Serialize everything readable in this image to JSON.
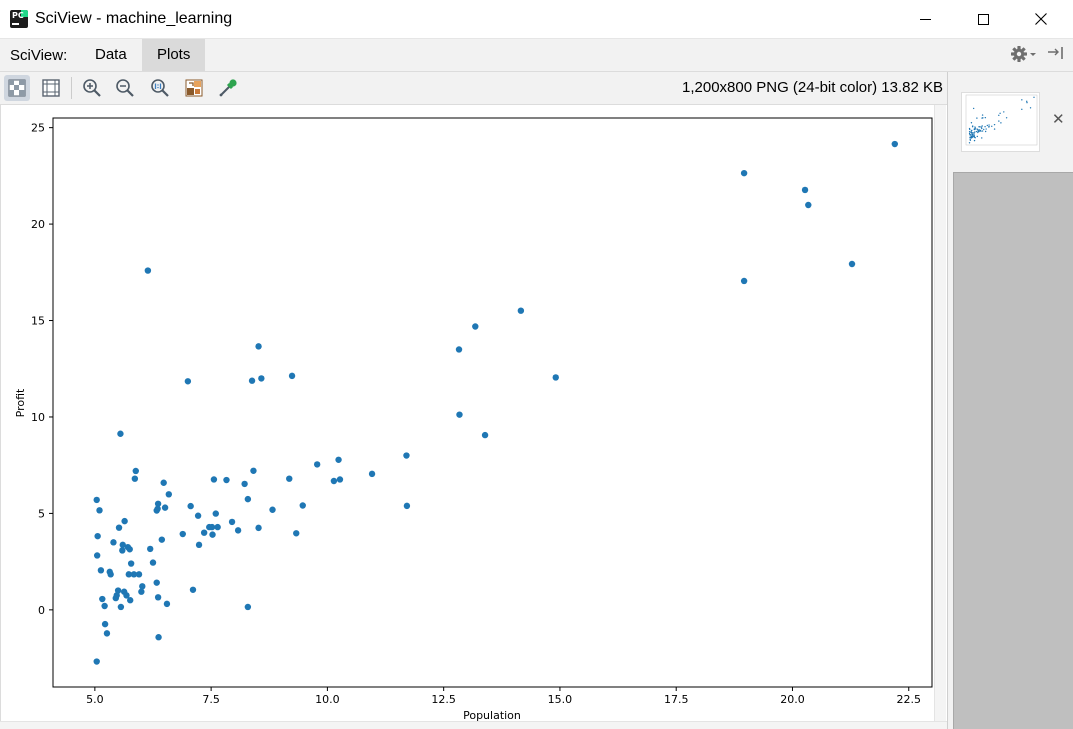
{
  "window": {
    "title": "SciView - machine_learning"
  },
  "tabs": {
    "prefix": "SciView:",
    "items": [
      "Data",
      "Plots"
    ],
    "active": "Plots"
  },
  "toolbar": {
    "tools": [
      "grid-toggle-icon",
      "fit-frame-icon",
      "zoom-in-icon",
      "zoom-out-icon",
      "actual-size-icon",
      "palette-icon",
      "color-picker-icon"
    ]
  },
  "image_info": "1,200x800 PNG (24-bit color) 13.82 KB",
  "colors": {
    "marker": "#1f77b4",
    "tab_active": "#dadada",
    "panel_gray": "#bfbfbf"
  },
  "chart_data": {
    "type": "scatter",
    "title": "",
    "xlabel": "Population",
    "ylabel": "Profit",
    "xlim": [
      4.1,
      23.0
    ],
    "ylim": [
      -4.0,
      25.5
    ],
    "xticks": [
      "5.0",
      "7.5",
      "10.0",
      "12.5",
      "15.0",
      "17.5",
      "20.0",
      "22.5"
    ],
    "yticks": [
      "0",
      "5",
      "10",
      "15",
      "20",
      "25"
    ],
    "grid": false,
    "points": [
      [
        5.04,
        5.7
      ],
      [
        5.1,
        5.16
      ],
      [
        5.06,
        3.82
      ],
      [
        5.05,
        2.82
      ],
      [
        5.13,
        2.05
      ],
      [
        5.16,
        0.56
      ],
      [
        5.22,
        -0.74
      ],
      [
        5.21,
        0.2
      ],
      [
        5.26,
        -1.22
      ],
      [
        5.04,
        -2.68
      ],
      [
        5.32,
        1.97
      ],
      [
        5.34,
        1.84
      ],
      [
        5.4,
        3.5
      ],
      [
        5.45,
        0.61
      ],
      [
        5.47,
        0.75
      ],
      [
        5.5,
        1.0
      ],
      [
        5.52,
        4.26
      ],
      [
        5.55,
        9.13
      ],
      [
        5.56,
        0.15
      ],
      [
        5.59,
        3.08
      ],
      [
        5.64,
        4.6
      ],
      [
        5.6,
        3.37
      ],
      [
        5.63,
        0.94
      ],
      [
        5.68,
        0.75
      ],
      [
        5.71,
        3.25
      ],
      [
        5.73,
        1.84
      ],
      [
        5.75,
        3.14
      ],
      [
        5.76,
        0.5
      ],
      [
        5.78,
        2.4
      ],
      [
        5.84,
        1.84
      ],
      [
        5.86,
        6.8
      ],
      [
        5.88,
        7.2
      ],
      [
        5.95,
        1.84
      ],
      [
        6.0,
        0.94
      ],
      [
        6.02,
        1.22
      ],
      [
        6.14,
        17.59
      ],
      [
        6.19,
        3.16
      ],
      [
        6.25,
        2.45
      ],
      [
        6.33,
        5.15
      ],
      [
        6.36,
        5.5
      ],
      [
        6.33,
        1.41
      ],
      [
        6.36,
        0.65
      ],
      [
        6.37,
        -1.42
      ],
      [
        6.35,
        5.24
      ],
      [
        6.44,
        3.64
      ],
      [
        6.48,
        6.59
      ],
      [
        6.55,
        0.31
      ],
      [
        6.51,
        5.3
      ],
      [
        6.59,
        5.99
      ],
      [
        6.89,
        3.93
      ],
      [
        7.0,
        11.85
      ],
      [
        7.06,
        5.38
      ],
      [
        7.11,
        1.04
      ],
      [
        7.22,
        4.88
      ],
      [
        7.24,
        3.37
      ],
      [
        7.35,
        4.0
      ],
      [
        7.46,
        4.29
      ],
      [
        7.52,
        4.29
      ],
      [
        7.56,
        6.76
      ],
      [
        7.53,
        3.9
      ],
      [
        7.6,
        4.99
      ],
      [
        7.64,
        4.29
      ],
      [
        7.83,
        6.73
      ],
      [
        7.95,
        4.56
      ],
      [
        8.08,
        4.12
      ],
      [
        8.22,
        6.53
      ],
      [
        8.29,
        5.74
      ],
      [
        8.29,
        0.15
      ],
      [
        8.38,
        11.88
      ],
      [
        8.41,
        7.21
      ],
      [
        8.52,
        13.66
      ],
      [
        8.52,
        4.25
      ],
      [
        8.58,
        12.0
      ],
      [
        8.82,
        5.19
      ],
      [
        9.18,
        6.8
      ],
      [
        9.24,
        12.13
      ],
      [
        9.33,
        3.97
      ],
      [
        9.47,
        5.41
      ],
      [
        9.78,
        7.54
      ],
      [
        10.14,
        6.68
      ],
      [
        10.24,
        7.78
      ],
      [
        10.27,
        6.76
      ],
      [
        10.96,
        7.05
      ],
      [
        11.7,
        8.0
      ],
      [
        11.71,
        5.39
      ],
      [
        12.83,
        13.5
      ],
      [
        12.84,
        10.12
      ],
      [
        13.18,
        14.69
      ],
      [
        13.39,
        9.06
      ],
      [
        14.16,
        15.51
      ],
      [
        14.91,
        12.05
      ],
      [
        18.96,
        22.64
      ],
      [
        18.96,
        17.05
      ],
      [
        20.27,
        21.77
      ],
      [
        20.34,
        20.99
      ],
      [
        21.28,
        17.93
      ],
      [
        22.2,
        24.15
      ]
    ]
  }
}
